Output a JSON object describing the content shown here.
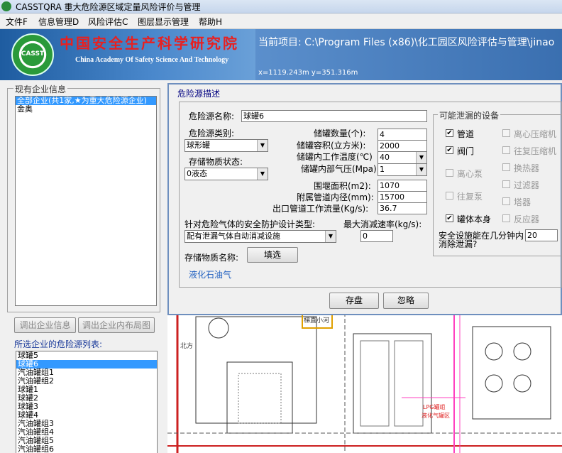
{
  "window": {
    "title": "CASSTQRA 重大危险源区域定量风险评价与管理"
  },
  "menu": [
    "文件F",
    "信息管理D",
    "风险评估C",
    "图层显示管理",
    "帮助H"
  ],
  "banner": {
    "logo_text": "CASST",
    "org_cn": "中国安全生产科学研究院",
    "org_en": "China Academy Of Safety Science And Technology"
  },
  "project": {
    "current": "当前项目: C:\\Program Files (x86)\\化工园区风险评估与管理\\jinao",
    "coords": "x=1119.243m  y=351.316m"
  },
  "enterprise_panel": {
    "legend": "现有企业信息",
    "items": [
      "全部企业(共1家,★为重大危险源企业)",
      "金奥"
    ],
    "selected_index": 0,
    "btn_info": "调出企业信息",
    "btn_layout": "调出企业内布局图"
  },
  "hazard_list": {
    "label": "所选企业的危险源列表:",
    "items": [
      "球罐5",
      "球罐6",
      "汽油罐组1",
      "汽油罐组2",
      "球罐1",
      "球罐2",
      "球罐3",
      "球罐4",
      "汽油罐组3",
      "汽油罐组4",
      "汽油罐组5",
      "汽油罐组6"
    ],
    "selected_index": 1
  },
  "dialog": {
    "title": "危险源描述",
    "name_label": "危险源名称:",
    "name_value": "球罐6",
    "category_label": "危险源类别:",
    "category_value": "球形罐",
    "state_label": "存储物质状态:",
    "state_value": "0液态",
    "tank_count_label": "储罐数量(个):",
    "tank_count_value": "4",
    "volume_label": "储罐容积(立方米):",
    "volume_value": "2000",
    "temp_label": "储罐内工作温度(℃)",
    "temp_value": "40",
    "pressure_label": "储罐内部气压(Mpa)",
    "pressure_value": "1",
    "dike_label": "围堰面积(m2):",
    "dike_value": "1070",
    "pipe_label": "附属管道内径(mm):",
    "pipe_value": "15700",
    "flow_label": "出口管道工作流量(Kg/s):",
    "flow_value": "36.7",
    "protect_label": "针对危险气体的安全防护设计类型:",
    "protect_value": "配有泄漏气体自动消减设施",
    "max_rate_label": "最大消减速率(kg/s):",
    "max_rate_value": "0",
    "substance_label": "存储物质名称:",
    "select_btn": "填选",
    "substance_value": "液化石油气",
    "save_btn": "存盘",
    "ignore_btn": "忽略",
    "devices_legend": "可能泄漏的设备",
    "devices": [
      {
        "label": "管道",
        "checked": true,
        "enabled": true
      },
      {
        "label": "离心压缩机",
        "checked": false,
        "enabled": false
      },
      {
        "label": "阀门",
        "checked": true,
        "enabled": true
      },
      {
        "label": "往复压缩机",
        "checked": false,
        "enabled": false
      },
      {
        "label": "离心泵",
        "checked": false,
        "enabled": false
      },
      {
        "label": "换热器",
        "checked": false,
        "enabled": false
      },
      {
        "label": "往复泵",
        "checked": false,
        "enabled": false
      },
      {
        "label": "过滤器",
        "checked": false,
        "enabled": false
      },
      {
        "label": "塔器",
        "checked": false,
        "enabled": false
      },
      {
        "label": "罐体本身",
        "checked": true,
        "enabled": true
      },
      {
        "label": "反应器",
        "checked": false,
        "enabled": false
      }
    ],
    "minutes_label_1": "安全设施能在几分钟内",
    "minutes_label_2": "消除泄漏?",
    "minutes_value": "20"
  },
  "map": {
    "labels": [
      "梯直小河",
      "LPG罐组",
      "液化气罐区"
    ],
    "compass": "北方"
  }
}
